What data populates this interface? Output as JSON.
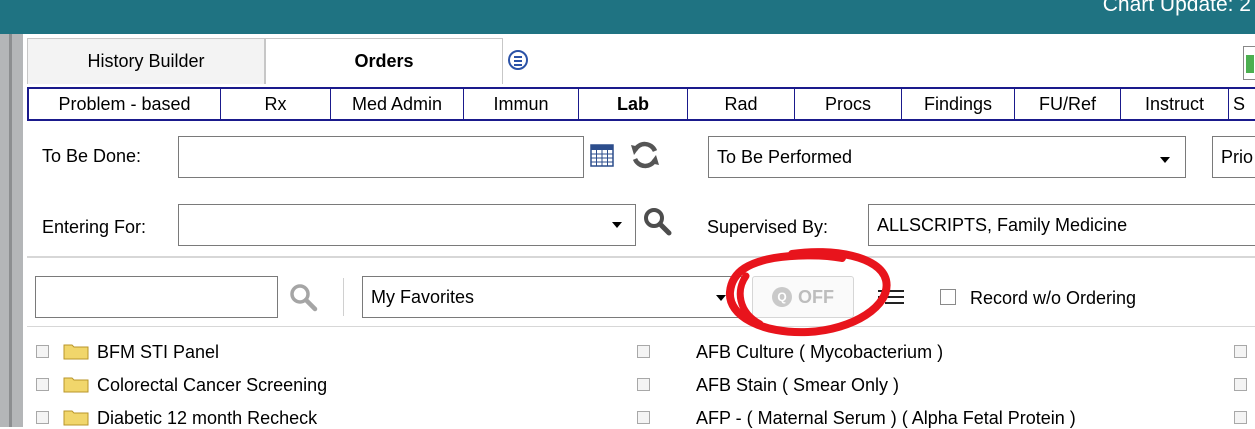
{
  "header": {
    "title": "Chart Update: 2"
  },
  "top_tabs": [
    {
      "label": "History Builder",
      "active": false
    },
    {
      "label": "Orders",
      "active": true
    }
  ],
  "order_tabs": [
    {
      "label": "Problem - based"
    },
    {
      "label": "Rx"
    },
    {
      "label": "Med Admin"
    },
    {
      "label": "Immun"
    },
    {
      "label": "Lab",
      "active": true
    },
    {
      "label": "Rad"
    },
    {
      "label": "Procs"
    },
    {
      "label": "Findings"
    },
    {
      "label": "FU/Ref"
    },
    {
      "label": "Instruct"
    },
    {
      "label": "S"
    }
  ],
  "form": {
    "to_be_done_label": "To Be Done:",
    "to_be_done_value": "",
    "status_value": "To Be Performed",
    "priority_partial": "Prio",
    "entering_for_label": "Entering For:",
    "entering_for_value": "",
    "supervised_by_label": "Supervised By:",
    "supervised_by_value": "ALLSCRIPTS, Family Medicine"
  },
  "search": {
    "value": "",
    "favorites_value": "My Favorites",
    "q_label": "Q",
    "toggle_label": "OFF",
    "record_wo_ordering_label": "Record w/o Ordering"
  },
  "list_left": [
    {
      "label": "BFM STI Panel"
    },
    {
      "label": "Colorectal Cancer Screening"
    },
    {
      "label": "Diabetic 12 month Recheck"
    }
  ],
  "list_right": [
    {
      "label": "AFB Culture ( Mycobacterium )"
    },
    {
      "label": "AFB Stain ( Smear Only )"
    },
    {
      "label": "AFP - ( Maternal Serum ) ( Alpha Fetal Protein )"
    }
  ],
  "colors": {
    "title_bar": "#1f7382",
    "tab_border": "#1a1a8c",
    "annotation": "#e8141c",
    "folder": "#f1d66b"
  }
}
